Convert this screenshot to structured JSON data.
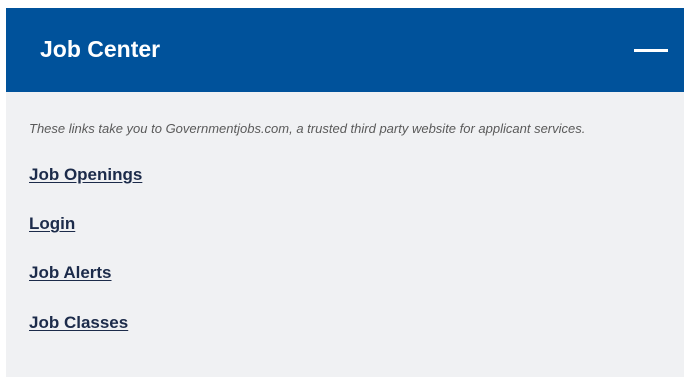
{
  "panel": {
    "title": "Job Center",
    "toggle_icon": "minus-icon",
    "note": "These links take you to Governmentjobs.com, a trusted third party website for applicant services.",
    "links": [
      {
        "label": "Job Openings"
      },
      {
        "label": "Login"
      },
      {
        "label": "Job Alerts"
      },
      {
        "label": "Job Classes"
      }
    ]
  },
  "colors": {
    "header_bg": "#00529b",
    "body_bg": "#f0f1f3",
    "link": "#1c2b4a"
  }
}
